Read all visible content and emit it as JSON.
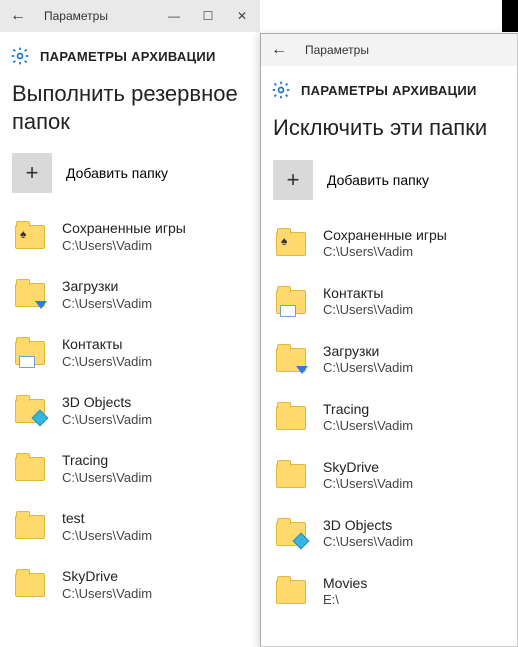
{
  "left": {
    "window_title": "Параметры",
    "section_title": "ПАРАМЕТРЫ АРХИВАЦИИ",
    "heading": "Выполнить резервное папок",
    "add_label": "Добавить папку",
    "items": [
      {
        "name": "Сохраненные игры",
        "path": "C:\\Users\\Vadim",
        "icon": "spade"
      },
      {
        "name": "Загрузки",
        "path": "C:\\Users\\Vadim",
        "icon": "download"
      },
      {
        "name": "Контакты",
        "path": "C:\\Users\\Vadim",
        "icon": "card"
      },
      {
        "name": "3D Objects",
        "path": "C:\\Users\\Vadim",
        "icon": "cube"
      },
      {
        "name": "Tracing",
        "path": "C:\\Users\\Vadim",
        "icon": "folder"
      },
      {
        "name": "test",
        "path": "C:\\Users\\Vadim",
        "icon": "folder"
      },
      {
        "name": "SkyDrive",
        "path": "C:\\Users\\Vadim",
        "icon": "folder"
      }
    ]
  },
  "right": {
    "window_title": "Параметры",
    "section_title": "ПАРАМЕТРЫ АРХИВАЦИИ",
    "heading": "Исключить эти папки",
    "add_label": "Добавить папку",
    "items": [
      {
        "name": "Сохраненные игры",
        "path": "C:\\Users\\Vadim",
        "icon": "spade"
      },
      {
        "name": "Контакты",
        "path": "C:\\Users\\Vadim",
        "icon": "card"
      },
      {
        "name": "Загрузки",
        "path": "C:\\Users\\Vadim",
        "icon": "download"
      },
      {
        "name": "Tracing",
        "path": "C:\\Users\\Vadim",
        "icon": "folder"
      },
      {
        "name": "SkyDrive",
        "path": "C:\\Users\\Vadim",
        "icon": "folder"
      },
      {
        "name": "3D Objects",
        "path": "C:\\Users\\Vadim",
        "icon": "cube"
      },
      {
        "name": "Movies",
        "path": "E:\\",
        "icon": "folder"
      }
    ]
  },
  "controls": {
    "min": "—",
    "max": "☐",
    "close": "✕"
  }
}
